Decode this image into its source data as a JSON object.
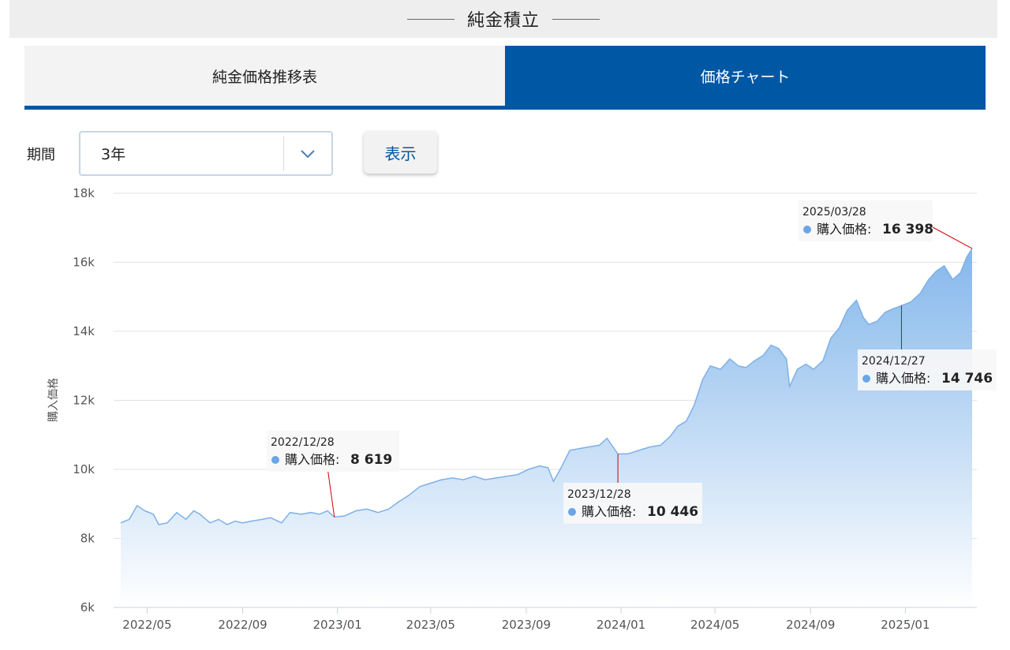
{
  "page_title": "純金積立",
  "tabs": [
    {
      "label": "純金価格推移表",
      "active": false
    },
    {
      "label": "価格チャート",
      "active": true
    }
  ],
  "filter": {
    "period_label": "期間",
    "period_value": "3年",
    "show_button": "表示"
  },
  "colors": {
    "accent": "#0057a3",
    "area_top": "#7fb4ea",
    "area_line": "#7fb0e6",
    "marker": "#6aa6e6",
    "leader": "#d40000"
  },
  "chart_data": {
    "type": "area",
    "title": "",
    "xlabel": "",
    "ylabel": "購入価格",
    "y_ticks": [
      "6k",
      "8k",
      "10k",
      "12k",
      "14k",
      "16k",
      "18k"
    ],
    "ylim": [
      6000,
      18000
    ],
    "x_ticks": [
      "2022/05",
      "2022/09",
      "2023/01",
      "2023/05",
      "2023/09",
      "2024/01",
      "2024/05",
      "2024/09",
      "2025/01"
    ],
    "xlim": [
      "2022-03-28",
      "2025-03-31"
    ],
    "grid": true,
    "series": [
      {
        "name": "購入価格",
        "points": [
          [
            "2022-03-28",
            8450
          ],
          [
            "2022-04-08",
            8550
          ],
          [
            "2022-04-18",
            8950
          ],
          [
            "2022-04-28",
            8800
          ],
          [
            "2022-05-09",
            8700
          ],
          [
            "2022-05-16",
            8400
          ],
          [
            "2022-05-27",
            8450
          ],
          [
            "2022-06-08",
            8750
          ],
          [
            "2022-06-20",
            8550
          ],
          [
            "2022-06-30",
            8800
          ],
          [
            "2022-07-08",
            8700
          ],
          [
            "2022-07-21",
            8450
          ],
          [
            "2022-08-01",
            8550
          ],
          [
            "2022-08-12",
            8400
          ],
          [
            "2022-08-22",
            8500
          ],
          [
            "2022-09-01",
            8450
          ],
          [
            "2022-09-12",
            8500
          ],
          [
            "2022-09-26",
            8550
          ],
          [
            "2022-10-07",
            8600
          ],
          [
            "2022-10-21",
            8450
          ],
          [
            "2022-11-01",
            8750
          ],
          [
            "2022-11-15",
            8700
          ],
          [
            "2022-11-28",
            8750
          ],
          [
            "2022-12-09",
            8700
          ],
          [
            "2022-12-19",
            8800
          ],
          [
            "2022-12-28",
            8619
          ],
          [
            "2023-01-10",
            8650
          ],
          [
            "2023-01-25",
            8800
          ],
          [
            "2023-02-08",
            8850
          ],
          [
            "2023-02-22",
            8750
          ],
          [
            "2023-03-08",
            8850
          ],
          [
            "2023-03-20",
            9050
          ],
          [
            "2023-04-03",
            9250
          ],
          [
            "2023-04-17",
            9500
          ],
          [
            "2023-05-01",
            9600
          ],
          [
            "2023-05-15",
            9700
          ],
          [
            "2023-05-29",
            9750
          ],
          [
            "2023-06-12",
            9700
          ],
          [
            "2023-06-26",
            9800
          ],
          [
            "2023-07-10",
            9700
          ],
          [
            "2023-07-24",
            9750
          ],
          [
            "2023-08-07",
            9800
          ],
          [
            "2023-08-21",
            9850
          ],
          [
            "2023-09-04",
            10000
          ],
          [
            "2023-09-18",
            10100
          ],
          [
            "2023-09-29",
            10050
          ],
          [
            "2023-10-06",
            9650
          ],
          [
            "2023-10-16",
            10050
          ],
          [
            "2023-10-27",
            10550
          ],
          [
            "2023-11-08",
            10600
          ],
          [
            "2023-11-20",
            10650
          ],
          [
            "2023-12-04",
            10700
          ],
          [
            "2023-12-14",
            10900
          ],
          [
            "2023-12-28",
            10446
          ],
          [
            "2024-01-10",
            10450
          ],
          [
            "2024-01-24",
            10550
          ],
          [
            "2024-02-07",
            10650
          ],
          [
            "2024-02-21",
            10700
          ],
          [
            "2024-03-04",
            10950
          ],
          [
            "2024-03-14",
            11250
          ],
          [
            "2024-03-25",
            11400
          ],
          [
            "2024-04-04",
            11850
          ],
          [
            "2024-04-15",
            12600
          ],
          [
            "2024-04-25",
            13000
          ],
          [
            "2024-05-08",
            12900
          ],
          [
            "2024-05-20",
            13200
          ],
          [
            "2024-05-31",
            13000
          ],
          [
            "2024-06-10",
            12950
          ],
          [
            "2024-06-21",
            13150
          ],
          [
            "2024-07-02",
            13300
          ],
          [
            "2024-07-12",
            13600
          ],
          [
            "2024-07-22",
            13500
          ],
          [
            "2024-08-01",
            13200
          ],
          [
            "2024-08-05",
            12400
          ],
          [
            "2024-08-15",
            12900
          ],
          [
            "2024-08-26",
            13050
          ],
          [
            "2024-09-05",
            12900
          ],
          [
            "2024-09-17",
            13150
          ],
          [
            "2024-09-27",
            13800
          ],
          [
            "2024-10-08",
            14100
          ],
          [
            "2024-10-18",
            14600
          ],
          [
            "2024-10-30",
            14900
          ],
          [
            "2024-11-08",
            14400
          ],
          [
            "2024-11-15",
            14200
          ],
          [
            "2024-11-26",
            14300
          ],
          [
            "2024-12-06",
            14550
          ],
          [
            "2024-12-16",
            14650
          ],
          [
            "2024-12-27",
            14746
          ],
          [
            "2025-01-08",
            14850
          ],
          [
            "2025-01-20",
            15100
          ],
          [
            "2025-01-31",
            15500
          ],
          [
            "2025-02-10",
            15750
          ],
          [
            "2025-02-20",
            15900
          ],
          [
            "2025-03-03",
            15500
          ],
          [
            "2025-03-13",
            15700
          ],
          [
            "2025-03-21",
            16150
          ],
          [
            "2025-03-28",
            16398
          ]
        ]
      }
    ],
    "annotations": [
      {
        "date": "2022/12/28",
        "label": "購入価格:",
        "value": "8 619"
      },
      {
        "date": "2023/12/28",
        "label": "購入価格:",
        "value": "10 446"
      },
      {
        "date": "2024/12/27",
        "label": "購入価格:",
        "value": "14 746"
      },
      {
        "date": "2025/03/28",
        "label": "購入価格:",
        "value": "16 398"
      }
    ]
  }
}
